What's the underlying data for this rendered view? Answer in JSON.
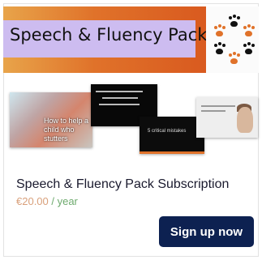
{
  "banner": {
    "title": "Speech & Fluency Pack",
    "paw_colors": [
      "#e0722a",
      "#111111"
    ]
  },
  "thumbnails": [
    {
      "caption": "How to help a child who stutters"
    },
    {
      "caption": ""
    },
    {
      "caption": "5 critical mistakes"
    },
    {
      "caption": ""
    }
  ],
  "product": {
    "title": "Speech & Fluency Pack Subscription",
    "price": "€20.00",
    "period": " / year"
  },
  "cta": {
    "label": "Sign up now",
    "color": "#0d2151"
  }
}
